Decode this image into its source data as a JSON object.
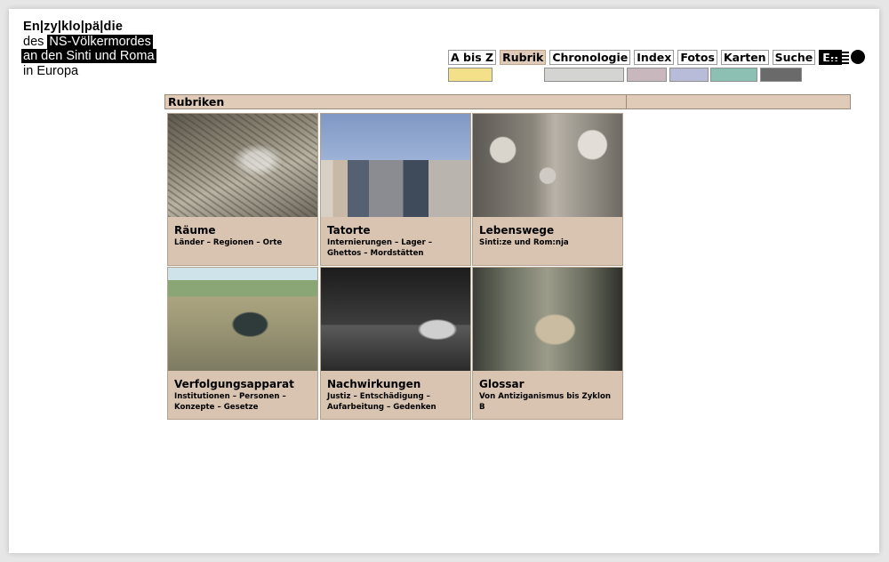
{
  "logo": {
    "line1": "En|zy|klo|pä|die",
    "line2_plain": "des",
    "line2_highlight": "NS-Völkermordes",
    "line3": "an den Sinti und Roma",
    "line4": "in Europa"
  },
  "nav": {
    "items": [
      {
        "label": "A bis Z",
        "swatch": "#f5e08a"
      },
      {
        "label": "Rubrik",
        "swatch": null
      },
      {
        "label": "Chronologie",
        "swatch": "#d4d4d2"
      },
      {
        "label": "Index",
        "swatch": "#c8b8be"
      },
      {
        "label": "Fotos",
        "swatch": "#b8bcd8"
      },
      {
        "label": "Karten",
        "swatch": "#8cc0b2"
      },
      {
        "label": "Suche",
        "swatch": "#6a6a6a"
      }
    ],
    "active": "Rubrik",
    "lang_label": "En",
    "menu_icon": "hamburger-icon",
    "circle_icon": "circle-icon"
  },
  "section": {
    "title": "Rubriken"
  },
  "cards": [
    {
      "title": "Räume",
      "subtitle": "Länder – Regionen – Orte"
    },
    {
      "title": "Tatorte",
      "subtitle": "Internierungen – Lager – Ghettos – Mordstätten"
    },
    {
      "title": "Lebenswege",
      "subtitle": "Sinti:ze und Rom:nja"
    },
    {
      "title": "Verfolgungsapparat",
      "subtitle": "Institutionen – Personen – Konzepte – Gesetze"
    },
    {
      "title": "Nachwirkungen",
      "subtitle": "Justiz – Entschädigung – Aufarbeitung – Gedenken"
    },
    {
      "title": "Glossar",
      "subtitle": "Von Antiziganismus bis Zyklon B"
    }
  ],
  "colors": {
    "accent": "#e0cbb8",
    "card_caption": "#d9c4b2"
  }
}
